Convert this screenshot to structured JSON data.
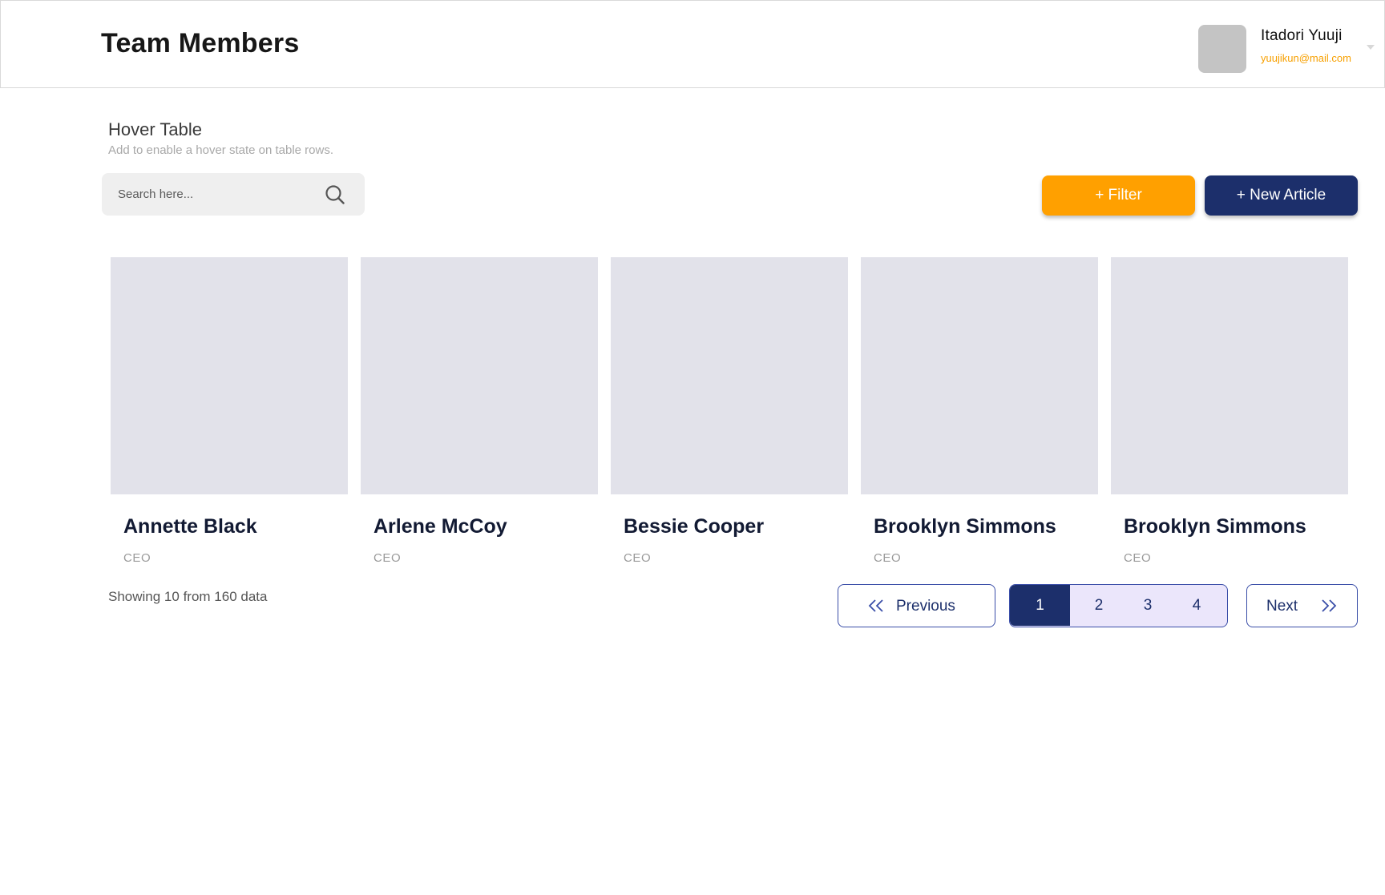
{
  "header": {
    "title": "Team Members",
    "user": {
      "name": "Itadori Yuuji",
      "email": "yuujikun@mail.com"
    }
  },
  "section": {
    "title": "Hover Table",
    "subtitle": "Add to enable a hover state on table rows."
  },
  "search": {
    "placeholder": "Search here...",
    "value": ""
  },
  "actions": {
    "filter_label": "+ Filter",
    "new_label": "+ New Article"
  },
  "members": [
    {
      "name": "Annette Black",
      "role": "CEO"
    },
    {
      "name": "Arlene McCoy",
      "role": "CEO"
    },
    {
      "name": "Bessie Cooper",
      "role": "CEO"
    },
    {
      "name": "Brooklyn Simmons",
      "role": "CEO"
    },
    {
      "name": "Brooklyn Simmons",
      "role": "CEO"
    }
  ],
  "pagination": {
    "summary": "Showing 10 from 160 data",
    "previous_label": "Previous",
    "next_label": "Next",
    "pages": [
      "1",
      "2",
      "3",
      "4"
    ],
    "current_page": "1"
  },
  "colors": {
    "accent_orange": "#ffa000",
    "primary_navy": "#1c2f6b",
    "pager_bg": "#ebe6fb",
    "photo_placeholder": "#e2e2ea"
  }
}
